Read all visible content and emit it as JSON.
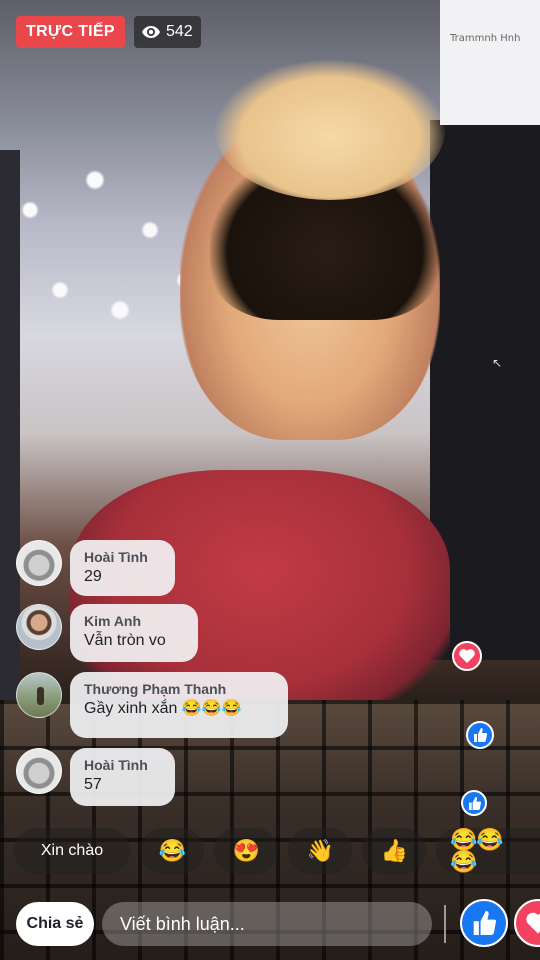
{
  "header": {
    "live_label": "TRỰC TIẾP",
    "viewer_count": "542",
    "live_color": "#e9474b"
  },
  "video": {
    "panel_text": "Trammnh Hnh"
  },
  "comments": [
    {
      "name": "Hoài Tình",
      "text": "29",
      "avatar": "pug-avatar"
    },
    {
      "name": "Kim Anh",
      "text": "Vẫn tròn vo",
      "avatar": "person-avatar"
    },
    {
      "name": "Thương Phạm Thanh",
      "text": "Gầy xinh xắn 😂😂😂",
      "avatar": "outdoor-avatar"
    },
    {
      "name": "Hoài Tình",
      "text": "57",
      "avatar": "pug-avatar"
    }
  ],
  "quick_replies": [
    {
      "label": "Xin chào"
    },
    {
      "label": "😂"
    },
    {
      "label": "😍"
    },
    {
      "label": "👋"
    },
    {
      "label": "👍"
    },
    {
      "label": "😂😂😂"
    }
  ],
  "footer": {
    "share_label": "Chia sẻ",
    "comment_placeholder": "Viết bình luận...",
    "like_color": "#1877f2",
    "love_color": "#f3425f"
  },
  "icons": [
    "eye-icon",
    "like-icon",
    "heart-icon"
  ]
}
